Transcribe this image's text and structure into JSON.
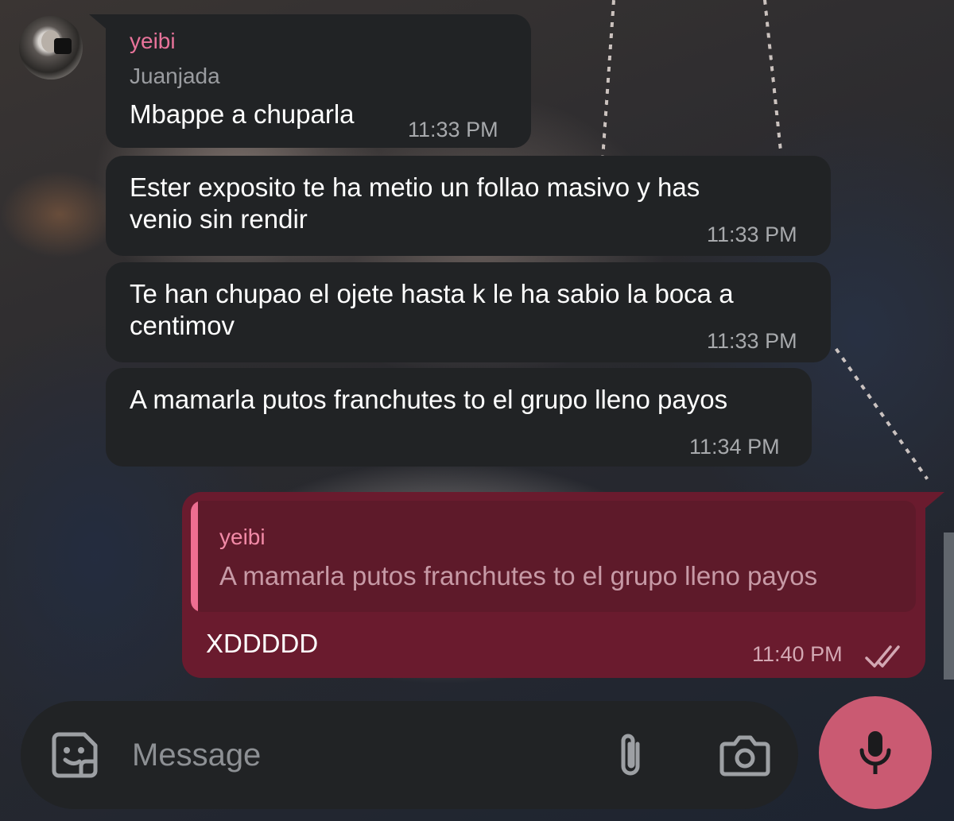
{
  "chat": {
    "incoming": {
      "sender_name": "yeibi",
      "chat_name": "Juanjada",
      "messages": [
        {
          "text": "Mbappe a chuparla",
          "time": "11:33 PM"
        },
        {
          "text": "Ester exposito te ha metio un follao masivo y has\nvenio sin rendir",
          "time": "11:33 PM"
        },
        {
          "text": "Te han chupao el ojete hasta k le ha sabio la boca a\ncentimov",
          "time": "11:33 PM"
        },
        {
          "text": "A mamarla putos franchutes to el grupo lleno payos",
          "time": "11:34 PM"
        }
      ]
    },
    "outgoing": {
      "reply_to": {
        "sender": "yeibi",
        "text": "A mamarla putos franchutes to el grupo lleno payos"
      },
      "text": "XDDDDD",
      "time": "11:40 PM",
      "status_icon": "double-check-icon"
    }
  },
  "composer": {
    "placeholder": "Message",
    "icons": [
      "sticker-icon",
      "paperclip-icon",
      "camera-icon",
      "microphone-icon"
    ]
  },
  "colors": {
    "incoming_bubble": "#212325",
    "outgoing_bubble": "#6a1b2e",
    "sender_name": "#e8739a",
    "mic_button": "#ca5a72"
  }
}
